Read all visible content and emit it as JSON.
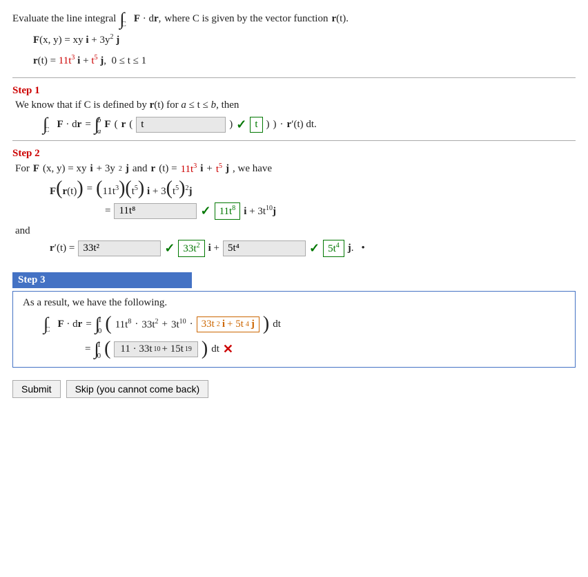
{
  "problem": {
    "intro": "Evaluate the line integral",
    "integral_symbol": "∫",
    "subscript_C": "C",
    "integrand": "F · dr,",
    "where_text": "where C is given by the vector function",
    "r_t": "r(t).",
    "F_def_label": "F(x, y) =",
    "F_def": "xy",
    "F_i": "i",
    "F_plus": "+",
    "F_3y2": "3y",
    "F_2exp": "2",
    "F_j": "j",
    "r_def_label": "r(t) =",
    "r_11t3": "11t",
    "r_3exp": "3",
    "r_i": "i",
    "r_plus": "+",
    "r_t5": "t",
    "r_5exp": "5",
    "r_j": "j,",
    "r_domain": "0 ≤ t ≤ 1"
  },
  "step1": {
    "header": "Step 1",
    "text": "We know that if C is defined by r(t) for",
    "domain_text": "a ≤ t ≤ b, then",
    "formula_left": "∫",
    "formula_C": "C",
    "formula_F_dr": "F · dr",
    "formula_eq": "=",
    "formula_int": "∫",
    "formula_a": "a",
    "formula_b": "b",
    "formula_F": "F",
    "formula_r": "r",
    "input_value": "t",
    "answer_value": "t",
    "formula_rprime": "r′(t) dt."
  },
  "step2": {
    "header": "Step 2",
    "text1": "For",
    "F_label": "F(x, y) = xy",
    "i_label": "i",
    "plus1": "+",
    "F_3y2": "3y",
    "exp2": "2",
    "j_label": "j",
    "and_text": "and",
    "r_label": "r(t) =",
    "r_11t3": "11t",
    "exp3": "3",
    "r_i2": "i",
    "r_plus2": "+",
    "r_t5": "t",
    "exp5": "5",
    "r_j2": "j,",
    "we_have": "we have",
    "F_r_t_label": "F",
    "F_r_t_r": "r(t)",
    "eq1": "=",
    "expr1": "(11t",
    "exp3b": "3",
    "expr2": ")(t",
    "exp5b": "5",
    "expr3": ")",
    "i3": "i",
    "plus3": "+",
    "coeff3": "3",
    "paren_open": "(",
    "t5_expr": "t",
    "exp5c": "5",
    "paren_close": ")",
    "exp2b": "2",
    "j3": "j",
    "eq2": "=",
    "input2_value": "11t",
    "input2_exp": "8",
    "answer2": "11t",
    "answer2_exp": "8",
    "answer2_rest": "i + 3t",
    "answer2_exp10": "10",
    "answer2_j": "j",
    "and_label": "and",
    "r_prime_label": "r′(t) =",
    "input3_value": "33t",
    "input3_exp": "2",
    "answer3": "33t",
    "answer3_exp": "2",
    "plus4": "+",
    "input4_value": "5t",
    "input4_exp": "4",
    "answer4": "5t",
    "answer4_exp": "4",
    "j4": "j.",
    "i4": "i"
  },
  "step3": {
    "header": "Step 3",
    "text": "As a result, we have the following.",
    "int_left": "∫",
    "C_sub": "C",
    "F_dr": "F · dr",
    "eq1": "=",
    "int1": "∫",
    "limit_lower": "0",
    "limit_upper": "1",
    "expr_start": "(11t",
    "exp8": "8",
    "dot": "·",
    "expr33t2": "33t",
    "exp2": "2",
    "plus1": "+",
    "expr3t10": "3t",
    "exp10": "10",
    "cdot": "·",
    "answer_inner": "33t",
    "answer_inner_exp2": "2",
    "answer_inner_i": "i",
    "answer_inner_plus": "+",
    "answer_inner_5t": "5t",
    "answer_inner_exp4": "4",
    "answer_inner_j": "j",
    "close_paren": ")",
    "dt1": "dt",
    "eq2": "=",
    "int2": "∫",
    "limit_lower2": "0",
    "limit_upper2": "1",
    "open_paren2": "(",
    "inner_expr": "11 · 33t",
    "inner_exp10": "10",
    "inner_plus": "+",
    "inner_15t": "15t",
    "inner_exp19": "19",
    "close_paren2": ")",
    "dt2": "dt",
    "xmark": "✕"
  },
  "buttons": {
    "submit": "Submit",
    "skip": "Skip (you cannot come back)"
  }
}
